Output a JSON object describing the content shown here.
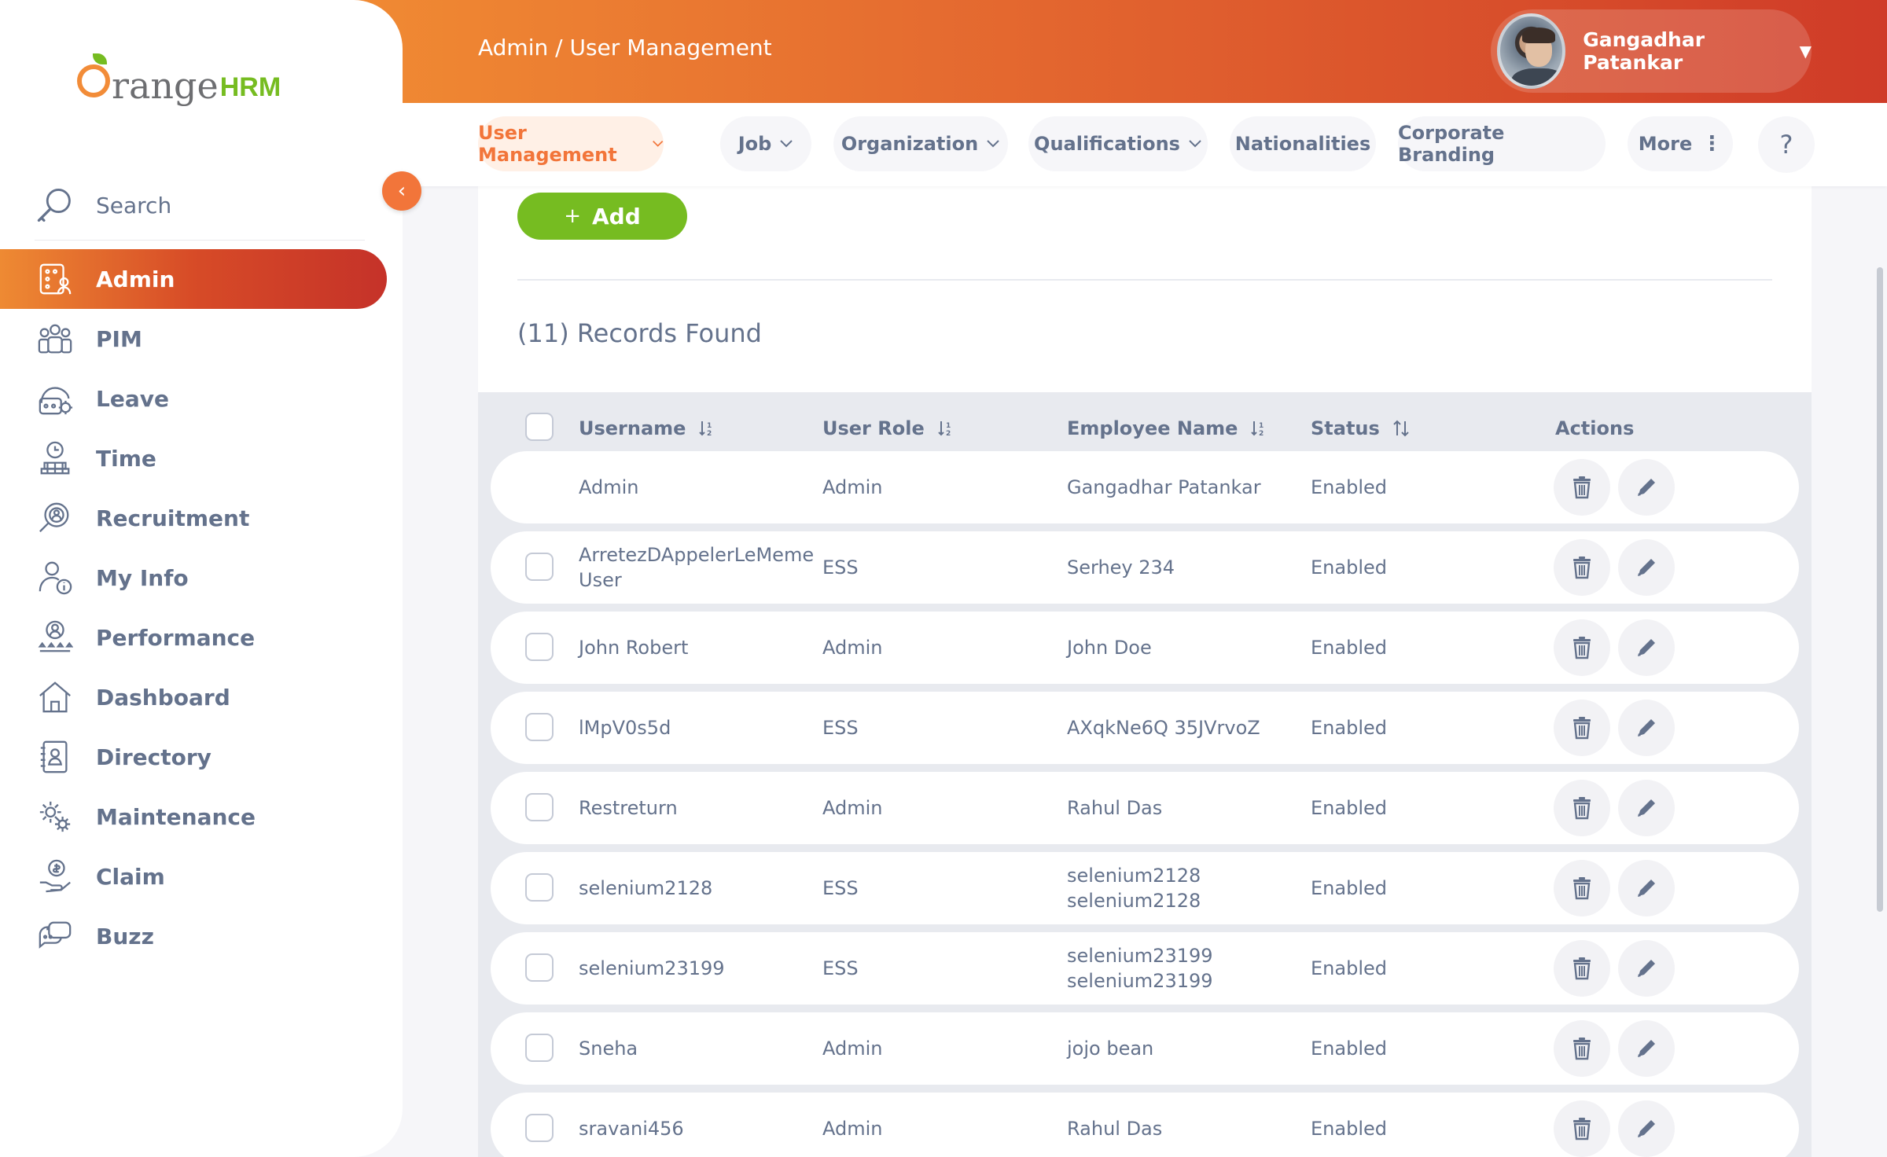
{
  "brand": {
    "part1": "range",
    "part2": "HRM"
  },
  "sidebar": {
    "search_label": "Search",
    "items": [
      {
        "label": "Admin",
        "icon": "admin-icon",
        "active": true
      },
      {
        "label": "PIM",
        "icon": "pim-icon",
        "active": false
      },
      {
        "label": "Leave",
        "icon": "leave-icon",
        "active": false
      },
      {
        "label": "Time",
        "icon": "time-icon",
        "active": false
      },
      {
        "label": "Recruitment",
        "icon": "recruitment-icon",
        "active": false
      },
      {
        "label": "My Info",
        "icon": "my-info-icon",
        "active": false
      },
      {
        "label": "Performance",
        "icon": "performance-icon",
        "active": false
      },
      {
        "label": "Dashboard",
        "icon": "dashboard-icon",
        "active": false
      },
      {
        "label": "Directory",
        "icon": "directory-icon",
        "active": false
      },
      {
        "label": "Maintenance",
        "icon": "maintenance-icon",
        "active": false
      },
      {
        "label": "Claim",
        "icon": "claim-icon",
        "active": false
      },
      {
        "label": "Buzz",
        "icon": "buzz-icon",
        "active": false
      }
    ]
  },
  "header": {
    "breadcrumb": "Admin / User Management",
    "user_name": "Gangadhar Patankar"
  },
  "nav": {
    "tabs": [
      {
        "label": "User Management",
        "dropdown": true,
        "active": true
      },
      {
        "label": "Job",
        "dropdown": true,
        "active": false
      },
      {
        "label": "Organization",
        "dropdown": true,
        "active": false
      },
      {
        "label": "Qualifications",
        "dropdown": true,
        "active": false
      },
      {
        "label": "Nationalities",
        "dropdown": false,
        "active": false
      },
      {
        "label": "Corporate Branding",
        "dropdown": false,
        "active": false
      },
      {
        "label": "More",
        "dropdown": false,
        "active": false
      }
    ],
    "help_label": "?"
  },
  "main": {
    "add_label": "Add",
    "records_found": "(11) Records Found",
    "columns": [
      "Username",
      "User Role",
      "Employee Name",
      "Status",
      "Actions"
    ],
    "rows": [
      {
        "username": "Admin",
        "role": "Admin",
        "employee": "Gangadhar Patankar",
        "status": "Enabled",
        "checkbox": false
      },
      {
        "username": "ArretezDAppelerLeMeme User",
        "role": "ESS",
        "employee": "Serhey 234",
        "status": "Enabled",
        "checkbox": true
      },
      {
        "username": "John Robert",
        "role": "Admin",
        "employee": "John Doe",
        "status": "Enabled",
        "checkbox": true
      },
      {
        "username": "lMpV0s5d",
        "role": "ESS",
        "employee": "AXqkNe6Q 35JVrvoZ",
        "status": "Enabled",
        "checkbox": true
      },
      {
        "username": "Restreturn",
        "role": "Admin",
        "employee": "Rahul Das",
        "status": "Enabled",
        "checkbox": true
      },
      {
        "username": "selenium2128",
        "role": "ESS",
        "employee": "selenium2128 selenium2128",
        "status": "Enabled",
        "checkbox": true
      },
      {
        "username": "selenium23199",
        "role": "ESS",
        "employee": "selenium23199 selenium23199",
        "status": "Enabled",
        "checkbox": true
      },
      {
        "username": "Sneha",
        "role": "Admin",
        "employee": "jojo bean",
        "status": "Enabled",
        "checkbox": true
      },
      {
        "username": "sravani456",
        "role": "Admin",
        "employee": "Rahul Das",
        "status": "Enabled",
        "checkbox": true
      }
    ]
  },
  "colors": {
    "accent": "#f2753a",
    "green": "#76bc21",
    "text": "#64728c"
  }
}
